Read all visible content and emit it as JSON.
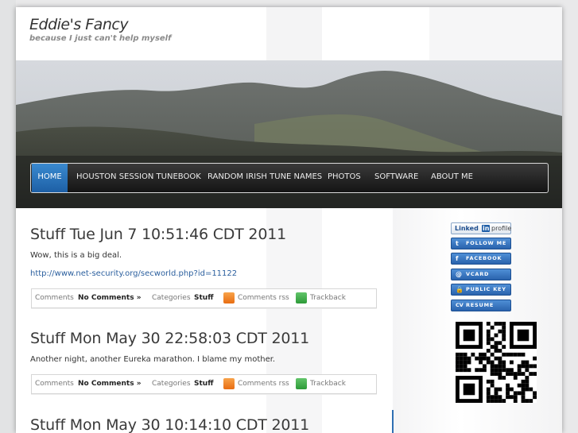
{
  "site": {
    "title": "Eddie's Fancy",
    "tagline": "because I just can't help myself"
  },
  "nav": {
    "items": [
      {
        "label": "Home",
        "active": true
      },
      {
        "label": "Houston Session Tunebook",
        "active": false
      },
      {
        "label": "Random Irish Tune Names",
        "active": false
      },
      {
        "label": "Photos",
        "active": false
      },
      {
        "label": "Software",
        "active": false
      },
      {
        "label": "About Me",
        "active": false
      }
    ]
  },
  "posts": [
    {
      "title": "Stuff Tue Jun 7 10:51:46 CDT 2011",
      "body": "Wow, this is a big deal.",
      "link": "http://www.net-security.org/secworld.php?id=11122",
      "meta": {
        "comments_label": "Comments",
        "comments_value": "No Comments »",
        "categories_label": "Categories",
        "categories_value": "Stuff",
        "rss_label": "Comments rss",
        "trackback_label": "Trackback"
      }
    },
    {
      "title": "Stuff Mon May 30 22:58:03 CDT 2011",
      "body": "Another night, another Eureka marathon. I blame my mother.",
      "meta": {
        "comments_label": "Comments",
        "comments_value": "No Comments »",
        "categories_label": "Categories",
        "categories_value": "Stuff",
        "rss_label": "Comments rss",
        "trackback_label": "Trackback"
      }
    },
    {
      "title": "Stuff Mon May 30 10:14:10 CDT 2011"
    }
  ],
  "sidebar": {
    "linkedin": {
      "brand": "Linked",
      "brand_in": "in",
      "suffix": "profile"
    },
    "buttons": [
      {
        "label": "FOLLOW ME",
        "icon": "twitter-icon",
        "glyph": "t"
      },
      {
        "label": "FACEBOOK",
        "icon": "facebook-icon",
        "glyph": "f"
      },
      {
        "label": "VCARD",
        "icon": "vcard-icon",
        "glyph": "@"
      },
      {
        "label": "PUBLIC KEY",
        "icon": "lock-icon",
        "glyph": "🔒"
      },
      {
        "label": "RESUME",
        "icon": "cv-icon",
        "glyph": "CV"
      }
    ],
    "qr_icon": "qr-code-icon"
  },
  "colors": {
    "nav_active": "#2f78c4",
    "link": "#2b5f9e",
    "sidebar_button": "#3a78c4"
  }
}
